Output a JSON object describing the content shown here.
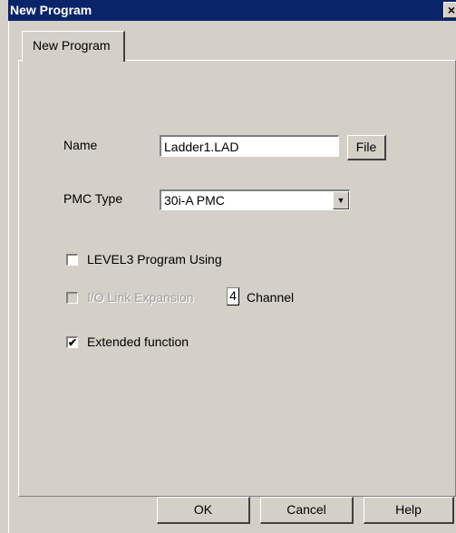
{
  "window": {
    "title": "New Program",
    "close_glyph": "×"
  },
  "tabs": [
    {
      "label": "New Program",
      "active": true
    }
  ],
  "form": {
    "name_label": "Name",
    "name_value": "Ladder1.LAD",
    "file_button": "File",
    "pmc_type_label": "PMC Type",
    "pmc_type_selected": "30i-A PMC",
    "level3_label": "LEVEL3 Program Using",
    "level3_checked": false,
    "io_link_label": "I/O Link Expansion",
    "io_link_checked": false,
    "io_link_enabled": false,
    "channel_value": "4",
    "channel_label": "Channel",
    "extended_label": "Extended function",
    "extended_checked": true,
    "check_glyph": "✔"
  },
  "buttons": {
    "ok": "OK",
    "cancel": "Cancel",
    "help": "Help"
  },
  "icons": {
    "dropdown": "triangle-down-icon",
    "close": "close-icon"
  }
}
